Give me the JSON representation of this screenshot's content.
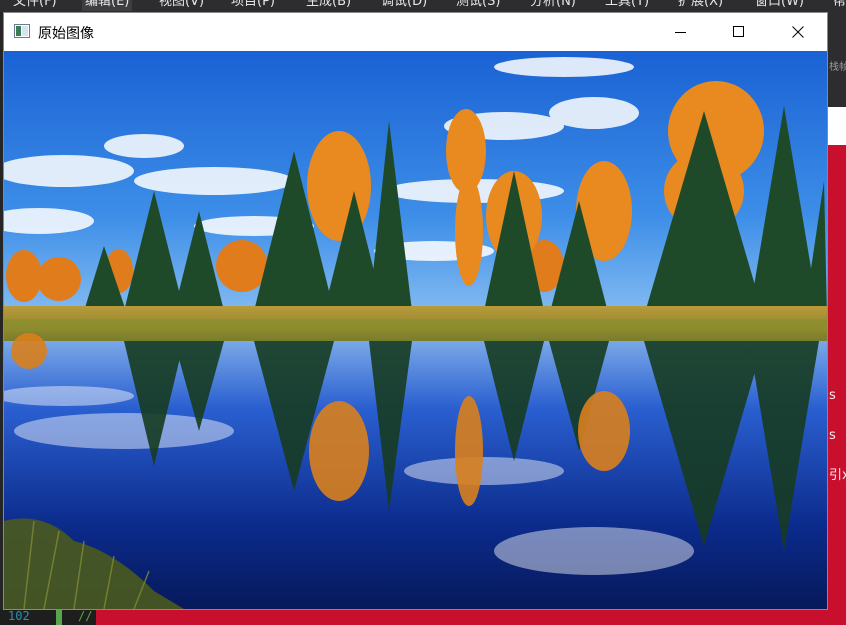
{
  "ide": {
    "menu": [
      {
        "label": "文件(F)"
      },
      {
        "label": "编辑(E)"
      },
      {
        "label": "视图(V)"
      },
      {
        "label": "项目(P)"
      },
      {
        "label": "生成(B)"
      },
      {
        "label": "调试(D)"
      },
      {
        "label": "测试(S)"
      },
      {
        "label": "分析(N)"
      },
      {
        "label": "工具(T)"
      },
      {
        "label": "扩展(X)"
      },
      {
        "label": "窗口(W)"
      },
      {
        "label": "帮"
      }
    ],
    "side_text": {
      "top": "栈帧",
      "s1": "s",
      "s2": "s",
      "s3": "引ⅹ"
    },
    "editor": {
      "line_number": "102",
      "comment": "//"
    }
  },
  "window": {
    "title": "原始图像",
    "icon": "image-window-icon",
    "buttons": {
      "minimize": "minimize-icon",
      "maximize": "maximize-icon",
      "close": "close-icon"
    },
    "image": {
      "subject": "Autumn landscape: evergreen and golden-leaved trees reflected in a calm blue lake under a blue sky with white clouds"
    }
  },
  "colors": {
    "ide_bg": "#1e1e1e",
    "accent_red": "#c8102e",
    "sky_blue": "#1e6fd9",
    "foliage_orange": "#e8891a",
    "pine_green": "#1f4a2a"
  }
}
